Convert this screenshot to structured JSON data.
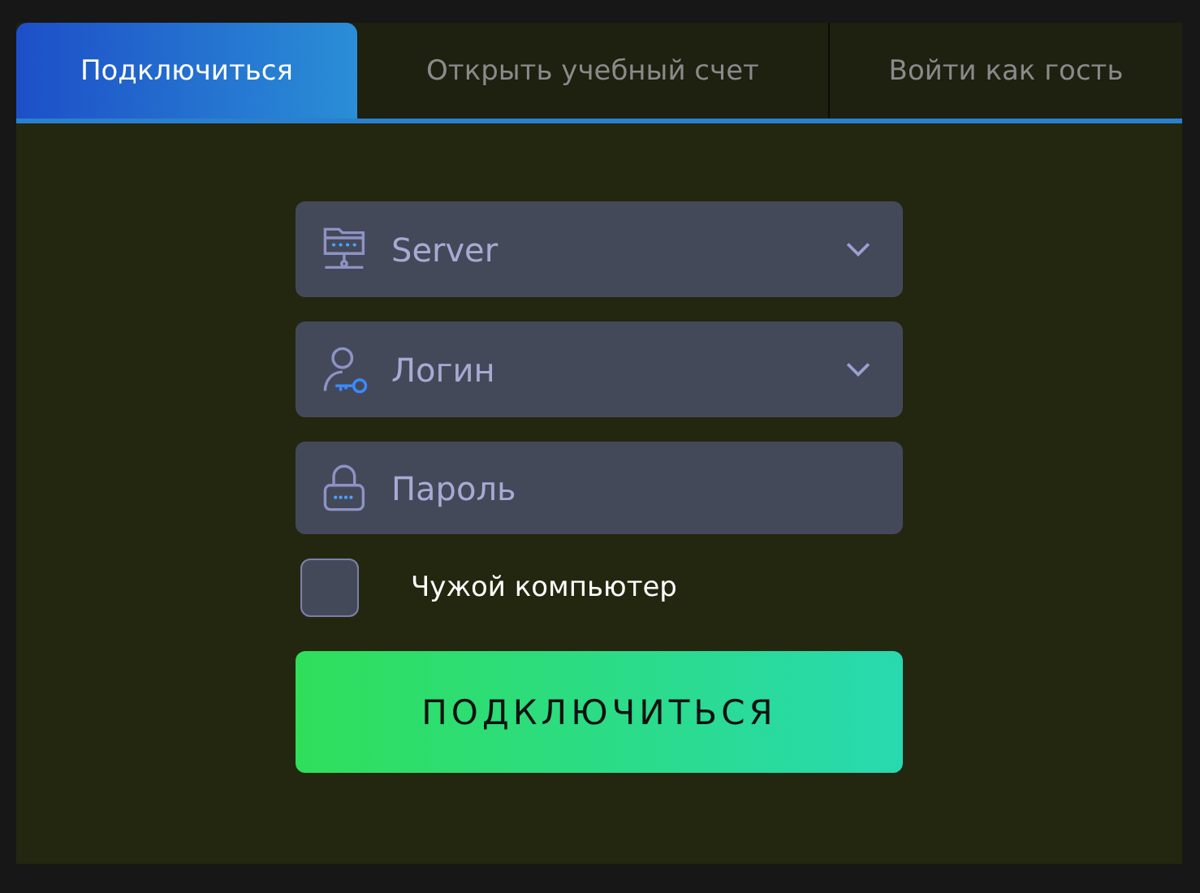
{
  "tabs": [
    {
      "label": "Подключиться",
      "selected": true
    },
    {
      "label": "Открыть учебный счет",
      "selected": false
    },
    {
      "label": "Войти как гость",
      "selected": false
    }
  ],
  "fields": [
    {
      "kind": "server",
      "placeholder": "Server"
    },
    {
      "kind": "login",
      "placeholder": "Логин"
    },
    {
      "kind": "password",
      "placeholder": "Пароль"
    }
  ],
  "checkbox": {
    "label": "Чужой компьютер",
    "checked": false
  },
  "submit": {
    "label": "ПОДКЛЮЧИТЬСЯ"
  }
}
